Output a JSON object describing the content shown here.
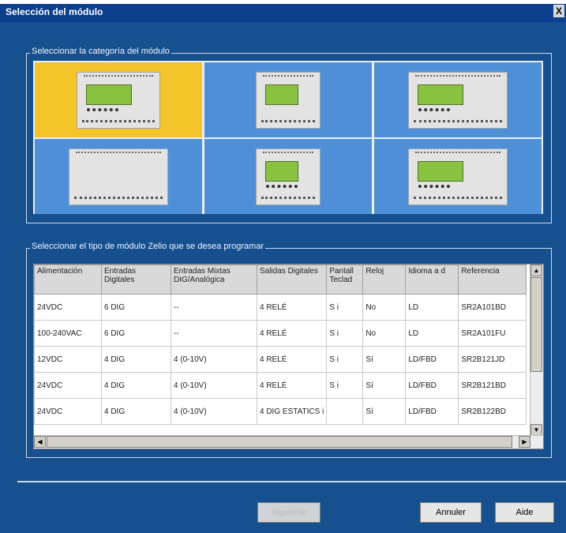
{
  "window": {
    "title": "Selección del módulo",
    "close_symbol": "X"
  },
  "category_group": {
    "label": "Seleccionar la categoría del módulo",
    "tiles": [
      {
        "id": "cat-1",
        "selected": true
      },
      {
        "id": "cat-2",
        "selected": false
      },
      {
        "id": "cat-3",
        "selected": false
      },
      {
        "id": "cat-4",
        "selected": false
      },
      {
        "id": "cat-5",
        "selected": false
      },
      {
        "id": "cat-6",
        "selected": false
      }
    ]
  },
  "module_group": {
    "label": "Seleccionar el tipo de módulo Zelio que se desea programar",
    "columns": [
      "Alimentación",
      "Entradas Digitales",
      "Entradas Mixtas DIG/Analógica",
      "Salidas Digitales",
      "Pantall Teclad",
      "Reloj",
      "Idioma a d",
      "Referencia"
    ],
    "rows": [
      [
        "24VDC",
        "6 DIG",
        "--",
        "4 RELÉ",
        "S i",
        "No",
        "LD",
        "SR2A101BD"
      ],
      [
        "100-240VAC",
        "6 DIG",
        "--",
        "4 RELÉ",
        "S i",
        "No",
        "LD",
        "SR2A101FU"
      ],
      [
        "12VDC",
        "4 DIG",
        "4 (0-10V)",
        "4 RELÉ",
        "S i",
        "Sí",
        "LD/FBD",
        "SR2B121JD"
      ],
      [
        "24VDC",
        "4 DIG",
        "4 (0-10V)",
        "4 RELÉ",
        "S i",
        "Sí",
        "LD/FBD",
        "SR2B121BD"
      ],
      [
        "24VDC",
        "4 DIG",
        "4 (0-10V)",
        "4 DIG ESTATICS i",
        "",
        "Sí",
        "LD/FBD",
        "SR2B122BD"
      ]
    ]
  },
  "footer": {
    "next_label": "Siguiente",
    "cancel_label": "Annuler",
    "help_label": "Aide"
  }
}
